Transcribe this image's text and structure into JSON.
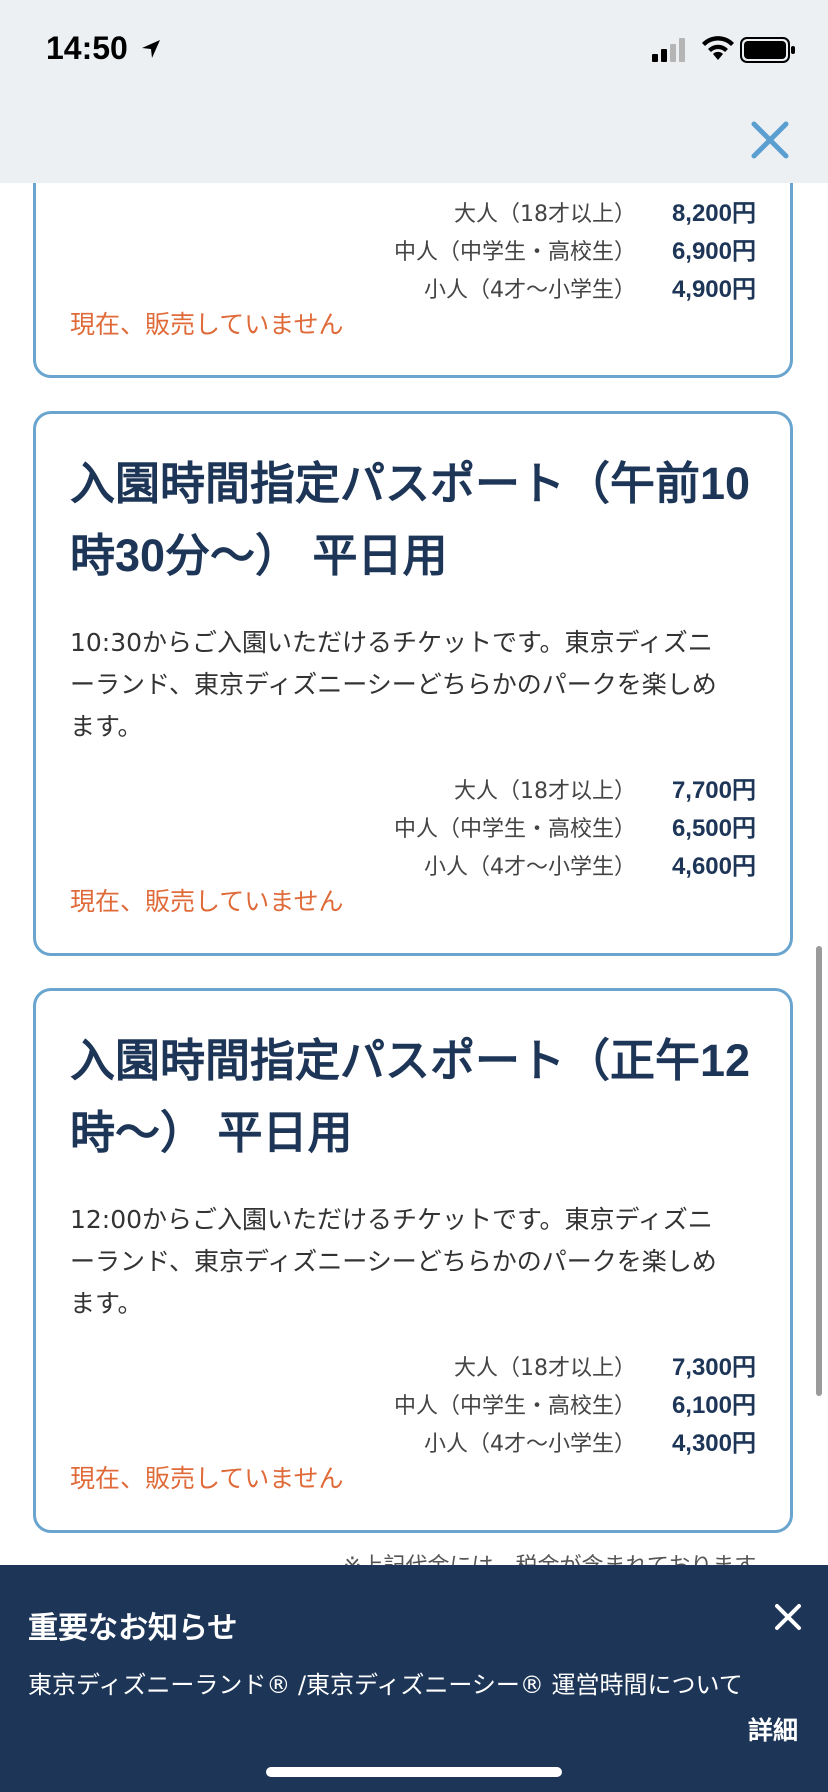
{
  "status_bar": {
    "time": "14:50"
  },
  "cards": [
    {
      "prices": [
        {
          "label": "大人（18才以上）",
          "value": "8,200円"
        },
        {
          "label": "中人（中学生・高校生）",
          "value": "6,900円"
        },
        {
          "label": "小人（4才〜小学生）",
          "value": "4,900円"
        }
      ],
      "status": "現在、販売していません"
    },
    {
      "title_line1": "入園時間指定パスポート（午前10",
      "title_line2": "時30分〜） 平日用",
      "desc_line1": "10:30からご入園いただけるチケットです。東京ディズニ",
      "desc_line2": "ーランド、東京ディズニーシーどちらかのパークを楽しめ",
      "desc_line3": "ます。",
      "prices": [
        {
          "label": "大人（18才以上）",
          "value": "7,700円"
        },
        {
          "label": "中人（中学生・高校生）",
          "value": "6,500円"
        },
        {
          "label": "小人（4才〜小学生）",
          "value": "4,600円"
        }
      ],
      "status": "現在、販売していません"
    },
    {
      "title_line1": "入園時間指定パスポート（正午12",
      "title_line2": "時〜） 平日用",
      "desc_line1": "12:00からご入園いただけるチケットです。東京ディズニ",
      "desc_line2": "ーランド、東京ディズニーシーどちらかのパークを楽しめ",
      "desc_line3": "ます。",
      "prices": [
        {
          "label": "大人（18才以上）",
          "value": "7,300円"
        },
        {
          "label": "中人（中学生・高校生）",
          "value": "6,100円"
        },
        {
          "label": "小人（4才〜小学生）",
          "value": "4,300円"
        }
      ],
      "status": "現在、販売していません"
    }
  ],
  "tax_note": "※上記代金には、税金が含まれております。",
  "notice": {
    "title": "重要なお知らせ",
    "link": "東京ディズニーランド® /東京ディズニーシー® 運営時間について",
    "detail": "詳細"
  },
  "colors": {
    "accent": "#1d3557",
    "border": "#6aa5cf",
    "status": "#e06b3a",
    "header_bg": "#edf0f3"
  }
}
